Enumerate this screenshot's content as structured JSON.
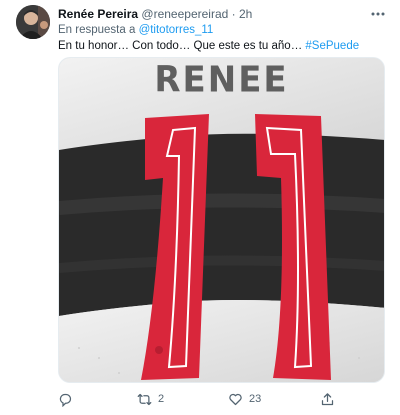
{
  "tweet": {
    "author": {
      "display_name": "Renée Pereira",
      "handle": "@reneepereirad",
      "separator": "·",
      "time": "2h"
    },
    "more_icon": "more-horizontal-icon",
    "reply_context": {
      "prefix": "En respuesta a",
      "handle": "@titotorres_11"
    },
    "text": "En tu honor… Con todo… Que este es tu año…",
    "hashtag": "#SePuede",
    "media": {
      "jersey_name": "RENEE",
      "jersey_number": "11",
      "colors": {
        "shirt_white": "#ebebeb",
        "shirt_black": "#2a2a2a",
        "number_red": "#d9263b"
      }
    },
    "actions": {
      "reply": {
        "icon": "reply-icon",
        "count": ""
      },
      "retweet": {
        "icon": "retweet-icon",
        "count": "2"
      },
      "like": {
        "icon": "heart-icon",
        "count": "23"
      },
      "share": {
        "icon": "share-icon",
        "count": ""
      }
    },
    "colors": {
      "accent": "#1d9bf0",
      "secondary_text": "#536471"
    }
  }
}
